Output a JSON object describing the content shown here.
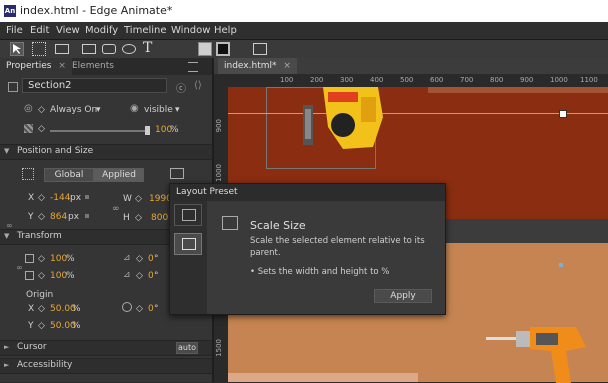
{
  "window": {
    "title": "index.html - Edge Animate*",
    "app_icon": "An"
  },
  "menu": [
    "File",
    "Edit",
    "View",
    "Modify",
    "Timeline",
    "Window",
    "Help"
  ],
  "panel": {
    "tabs": [
      "Properties",
      "Elements"
    ],
    "tab_close": "×",
    "element_name": "Section2",
    "always_on": "Always On",
    "visible": "visible",
    "opacity": "100",
    "opacity_unit": "%",
    "sections": {
      "position_size": "Position and Size",
      "transform": "Transform",
      "cursor": "Cursor",
      "accessibility": "Accessibility"
    },
    "global_btn": "Global",
    "applied_btn": "Applied",
    "x_label": "X",
    "x_value": "-144",
    "y_label": "Y",
    "y_value": "864",
    "unit_px": "px",
    "w_label": "W",
    "w_value": "1990",
    "h_label": "H",
    "h_value": "800",
    "scale_x": "100",
    "scale_y": "100",
    "skew_x": "0",
    "rotate": "0",
    "rotate2": "0",
    "deg": "°",
    "pct": "%",
    "origin_label": "Origin",
    "origin_x_label": "X",
    "origin_x": "50.00",
    "origin_y_label": "Y",
    "origin_y": "50.00",
    "cursor_value": "auto"
  },
  "stage": {
    "doc_tab": "index.html*",
    "ruler_top": [
      "100",
      "200",
      "300",
      "400",
      "500",
      "600",
      "700",
      "800",
      "900",
      "1000",
      "1100"
    ],
    "ruler_left": [
      "900",
      "1000",
      "1500"
    ]
  },
  "popup": {
    "title": "Layout Preset",
    "heading": "Scale Size",
    "description": "Scale the selected element relative to its parent.",
    "bullet": "• Sets the width and height to %",
    "apply": "Apply"
  },
  "colors": {
    "accent_value": "#e8a735",
    "canvas_top": "#8a2d10",
    "canvas_bottom": "#c58451"
  }
}
